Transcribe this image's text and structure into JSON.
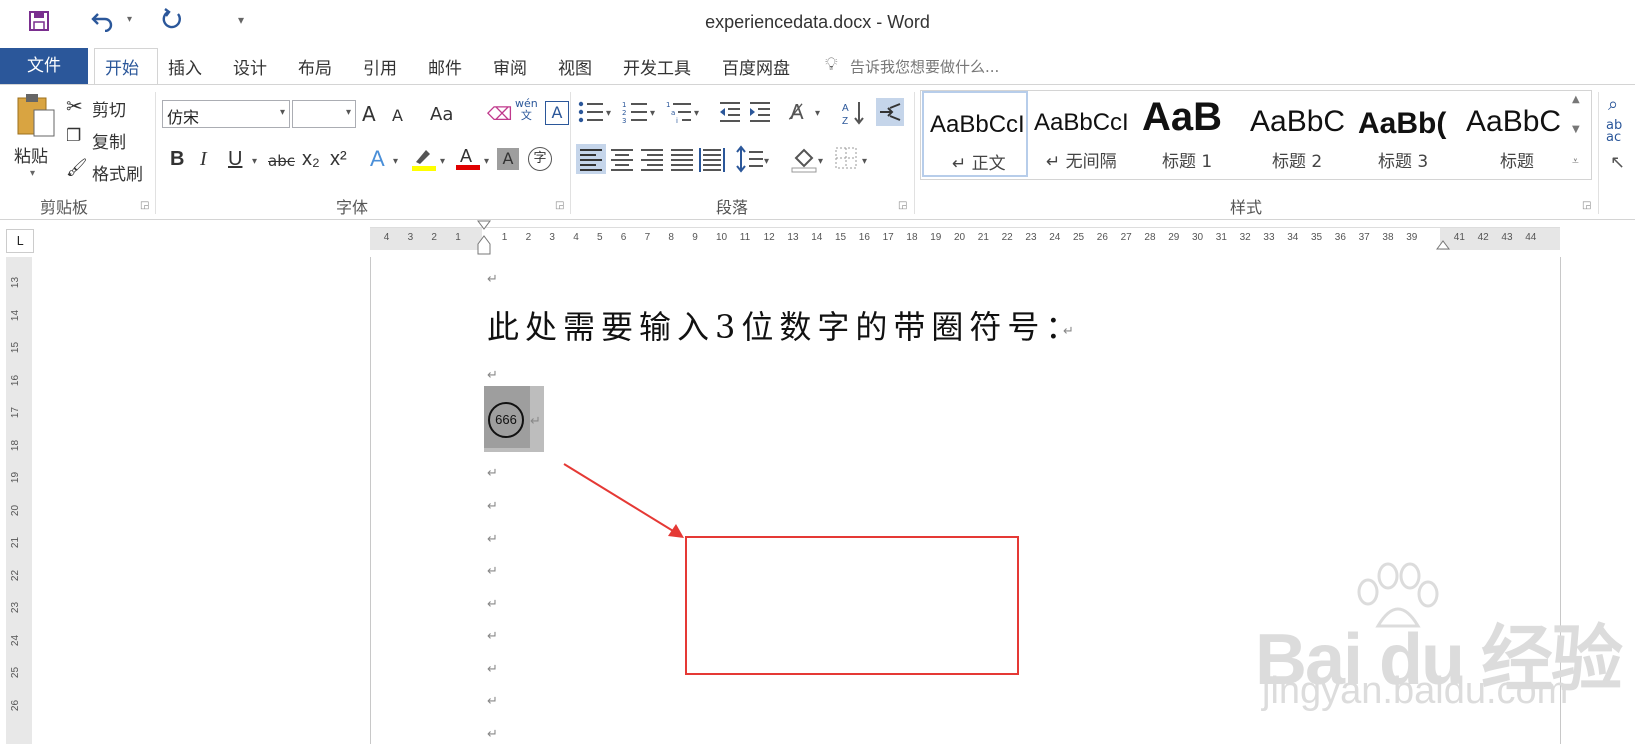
{
  "window": {
    "title": "experiencedata.docx - Word"
  },
  "tabs": [
    "文件",
    "开始",
    "插入",
    "设计",
    "布局",
    "引用",
    "邮件",
    "审阅",
    "视图",
    "开发工具",
    "百度网盘"
  ],
  "tell_me": "告诉我您想要做什么...",
  "clipboard": {
    "paste": "粘贴",
    "cut": "剪切",
    "copy": "复制",
    "format_painter": "格式刷",
    "label": "剪贴板"
  },
  "font": {
    "name": "仿宋",
    "size": "",
    "grow": "A",
    "shrink": "A",
    "case": "Aa",
    "phonetic": "wén\n文",
    "label": "字体",
    "bold": "B",
    "italic": "I",
    "underline": "U",
    "strike": "abc",
    "sub": "x₂",
    "sup": "x²",
    "circle_char": "字"
  },
  "paragraph": {
    "label": "段落"
  },
  "styles": {
    "label": "样式",
    "items": [
      {
        "sample": "AaBbCcI",
        "name": "↵ 正文"
      },
      {
        "sample": "AaBbCcI",
        "name": "↵ 无间隔"
      },
      {
        "sample": "AaB",
        "name": "标题 1"
      },
      {
        "sample": "AaBbC",
        "name": "标题 2"
      },
      {
        "sample": "AaBb(",
        "name": "标题 3"
      },
      {
        "sample": "AaBbC",
        "name": "标题"
      }
    ]
  },
  "ruler": {
    "h_left": [
      "4",
      "3",
      "2",
      "1"
    ],
    "h_right": [
      "1",
      "2",
      "3",
      "4",
      "5",
      "6",
      "7",
      "8",
      "9",
      "10",
      "11",
      "12",
      "13",
      "14",
      "15",
      "16",
      "17",
      "18",
      "19",
      "20",
      "21",
      "22",
      "23",
      "24",
      "25",
      "26",
      "27",
      "28",
      "29",
      "30",
      "31",
      "32",
      "33",
      "34",
      "35",
      "36",
      "37",
      "38",
      "39"
    ],
    "h_margin": [
      "41",
      "42",
      "43",
      "44"
    ],
    "v": [
      "13",
      "14",
      "15",
      "16",
      "17",
      "18",
      "19",
      "20",
      "21",
      "22",
      "23",
      "24",
      "25",
      "26"
    ],
    "corner": "L"
  },
  "document": {
    "para_mark": "↵",
    "heading": "此处需要输入3位数字的带圈符号：",
    "circled_number": "666"
  },
  "watermark": {
    "logo": "Bai du 经验",
    "site": "jingyan.baidu.com"
  },
  "colors": {
    "accent": "#2b579a",
    "highlight": "#e53935"
  }
}
